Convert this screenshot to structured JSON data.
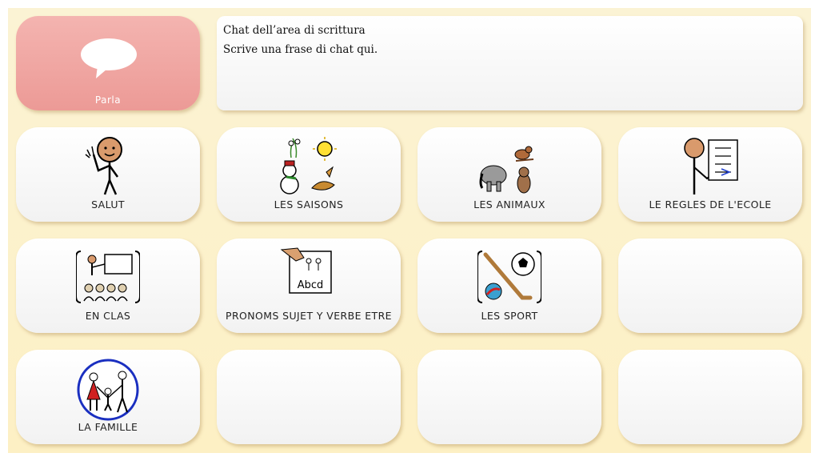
{
  "speak_button": {
    "label": "Parla",
    "icon": "speech-bubble-icon"
  },
  "chat_area": {
    "title": "Chat dell’area di scrittura",
    "text": "Scrive una frase di chat qui."
  },
  "tiles": [
    {
      "label": "SALUT",
      "icon": "waving-person-icon"
    },
    {
      "label": "LES SAISONS",
      "icon": "seasons-icon"
    },
    {
      "label": "LES ANIMAUX",
      "icon": "animals-icon"
    },
    {
      "label": "LE REGLES DE L'ECOLE",
      "icon": "school-rules-icon"
    },
    {
      "label": "EN CLAS",
      "icon": "classroom-icon"
    },
    {
      "label": "PRONOMS SUJET Y VERBE ETRE",
      "icon": "pronouns-icon"
    },
    {
      "label": "LES SPORT",
      "icon": "sports-icon"
    },
    {
      "label": "",
      "icon": ""
    },
    {
      "label": "LA FAMILLE",
      "icon": "family-icon"
    },
    {
      "label": "",
      "icon": ""
    },
    {
      "label": "",
      "icon": ""
    },
    {
      "label": "",
      "icon": ""
    }
  ],
  "colors": {
    "background": "#fcf2cf",
    "speak_button": "#f0a6a2",
    "tile": "#ffffff"
  }
}
